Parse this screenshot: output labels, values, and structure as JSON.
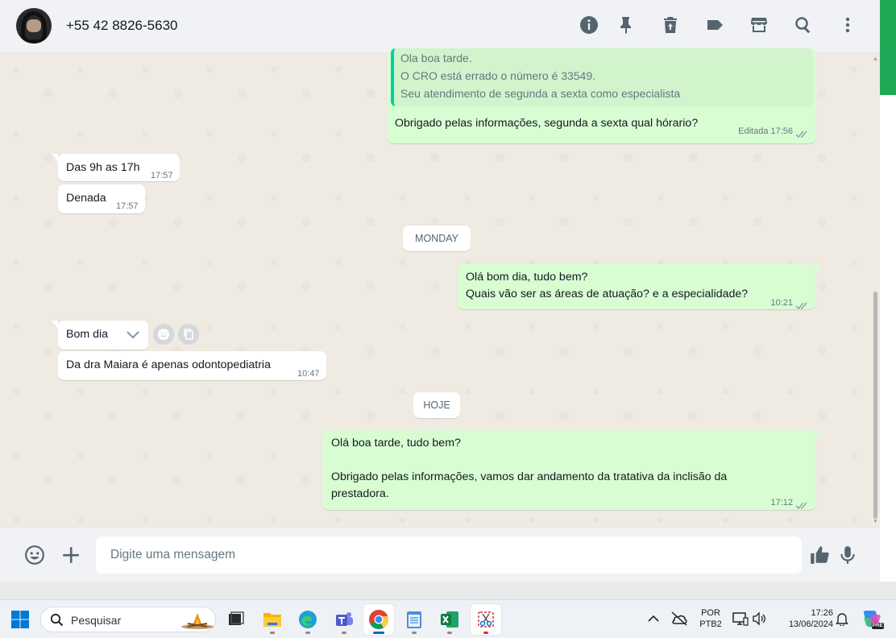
{
  "header": {
    "contact_name": "+55 42 8826-5630",
    "icons": [
      "info-icon",
      "pin-icon",
      "delete-icon",
      "label-icon",
      "store-icon",
      "search-icon",
      "menu-icon"
    ]
  },
  "messages": [
    {
      "direction": "out",
      "quoted_lines": [
        "Ola boa tarde.",
        "O CRO está errado o número é 33549.",
        "Seu atendimento de segunda a sexta como especialista"
      ],
      "text": "Obrigado pelas informações, segunda a sexta qual hórario?",
      "edited_label": "Editada",
      "time": "17:56"
    },
    {
      "direction": "in",
      "text": "Das 9h as 17h",
      "time": "17:57"
    },
    {
      "direction": "in",
      "text": "Denada",
      "time": "17:57"
    },
    {
      "direction": "out",
      "lines": [
        "Olá bom dia, tudo bem?",
        "Quais vão ser as áreas de atuação? e a especialidade?"
      ],
      "time": "10:21"
    },
    {
      "direction": "in",
      "text": "Bom dia",
      "time": ""
    },
    {
      "direction": "in",
      "text": "Da dra Maiara é apenas odontopediatria",
      "time": "10:47"
    },
    {
      "direction": "out",
      "lines": [
        "Olá boa tarde, tudo bem?",
        "",
        "Obrigado pelas informações, vamos dar andamento da tratativa da inclisão da",
        "prestadora."
      ],
      "time": "17:12"
    }
  ],
  "date_separators": {
    "monday": "MONDAY",
    "today": "HOJE"
  },
  "composer": {
    "placeholder": "Digite uma mensagem"
  },
  "taskbar": {
    "search_label": "Pesquisar",
    "language_top": "POR",
    "language_bottom": "PTB2",
    "time": "17:26",
    "date": "13/06/2024",
    "copilot_badge": "PRE"
  },
  "colors": {
    "outgoing_bubble": "#d9fdd3",
    "incoming_bubble": "#ffffff",
    "quote_bar": "#06cf9c",
    "chat_background": "#efeae2",
    "accent_green": "#1fa855"
  }
}
